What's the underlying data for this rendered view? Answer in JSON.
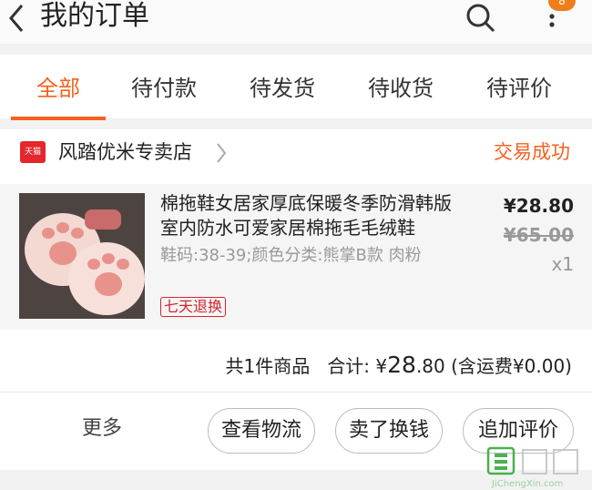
{
  "header": {
    "title": "我的订单",
    "back_icon": "chevron-left-icon",
    "search_icon": "search-icon",
    "more_icon": "more-vertical-icon",
    "badge": "8"
  },
  "tabs": [
    {
      "label": "全部",
      "active": true
    },
    {
      "label": "待付款"
    },
    {
      "label": "待发货"
    },
    {
      "label": "待收货"
    },
    {
      "label": "待评价"
    }
  ],
  "order": {
    "store": {
      "badge": "天猫",
      "name": "风踏优米专卖店",
      "status": "交易成功"
    },
    "item": {
      "title": "棉拖鞋女居家厚底保暖冬季防滑韩版室内防水可爱家居棉拖毛毛绒鞋",
      "sku": "鞋码:38-39;颜色分类:熊掌B款 肉粉",
      "return_badge": "七天退换",
      "price": "¥28.80",
      "original_price": "¥65.00",
      "quantity": "x1"
    },
    "summary": {
      "count_text": "共1件商品",
      "total_label": "合计: ¥",
      "total_int": "28",
      "total_dec": ".80",
      "shipping_text": "(含运费¥0.00)"
    },
    "actions": {
      "more": "更多",
      "logistics": "查看物流",
      "resell": "卖了换钱",
      "review": "追加评价"
    }
  },
  "watermark": {
    "text": "JiChengXin.com"
  },
  "colors": {
    "accent": "#f5611e",
    "tmall": "#e4262d",
    "badge": "#f07d1c"
  }
}
